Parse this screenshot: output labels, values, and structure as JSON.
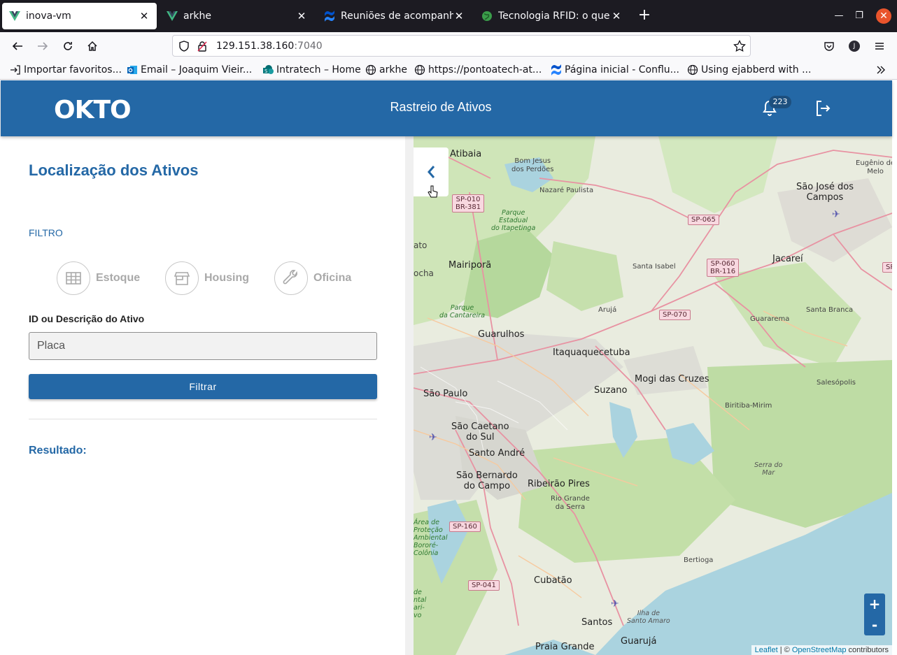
{
  "browser": {
    "tabs": [
      {
        "title": "inova-vm",
        "active": true,
        "icon": "vue-icon"
      },
      {
        "title": "arkhe",
        "active": false,
        "icon": "vue-icon"
      },
      {
        "title": "Reuniões de acompanhar",
        "active": false,
        "icon": "confluence-icon"
      },
      {
        "title": "Tecnologia RFID: o que é",
        "active": false,
        "icon": "globe-green-icon"
      }
    ],
    "url_host": "129.151.38.160",
    "url_port": ":7040",
    "profile_initial": "J",
    "bookmarks": [
      {
        "label": "Importar favoritos...",
        "icon": "import-icon"
      },
      {
        "label": "Email – Joaquim Vieir...",
        "icon": "outlook-icon"
      },
      {
        "label": "Intratech – Home",
        "icon": "sharepoint-icon"
      },
      {
        "label": "arkhe",
        "icon": "globe-icon"
      },
      {
        "label": "https://pontoatech-at...",
        "icon": "globe-icon"
      },
      {
        "label": "Página inicial - Conflu...",
        "icon": "confluence-icon"
      },
      {
        "label": "Using ejabberd with ...",
        "icon": "globe-icon"
      }
    ]
  },
  "header": {
    "logo": "OKTO",
    "title": "Rastreio de Ativos",
    "notification_count": "223"
  },
  "panel": {
    "title": "Localização dos Ativos",
    "filter_label": "FILTRO",
    "filters": [
      {
        "label": "Estoque",
        "icon": "grid-icon"
      },
      {
        "label": "Housing",
        "icon": "store-icon"
      },
      {
        "label": "Oficina",
        "icon": "wrench-icon"
      }
    ],
    "field_label": "ID ou Descrição do Ativo",
    "field_placeholder": "Placa",
    "filter_button": "Filtrar",
    "result_label": "Resultado:"
  },
  "map": {
    "places": {
      "atibaia": "Atibaia",
      "bom_jesus": "Bom Jesus\ndos Perdões",
      "nazare": "Nazaré Paulista",
      "sao_jose": "São José dos\nCampos",
      "eugenio": "Eugênio de\nMelo",
      "mairipora": "Mairiporã",
      "santa_isabel": "Santa Isabel",
      "jacarei": "Jacareí",
      "aruja": "Arujá",
      "santa_branca": "Santa Branca",
      "guararema": "Guararema",
      "guarulhos": "Guarulhos",
      "itaqua": "Itaquaquecetuba",
      "mogi": "Mogi das Cruzes",
      "suzano": "Suzano",
      "salesopolis": "Salesópolis",
      "sao_paulo": "São Paulo",
      "biritiba": "Biritiba-Mirim",
      "sao_caetano": "São Caetano\ndo Sul",
      "santo_andre": "Santo André",
      "sao_bernardo": "São Bernardo\ndo Campo",
      "ribeirao": "Ribeirão Pires",
      "rio_grande": "Rio Grande\nda Serra",
      "cubatao": "Cubatão",
      "santos": "Santos",
      "guaruja": "Guarujá",
      "praia_grande": "Praia Grande",
      "bertioga": "Bertioga",
      "ilha": "Ilha de\nSanto Amaro",
      "serra_mar": "Serra do\nMar",
      "pq_itapetinga": "Parque\nEstadual\ndo Itapetinga",
      "pq_cantareira": "Parque\nda Cantareira",
      "ato": "ato",
      "ocha": "ocha",
      "area_protecao": "Área de\nProteção\nAmbiental\nBororé-\nColônia",
      "ental": "de\nntal\nari-\nvo"
    },
    "shields": {
      "sp010": "SP-010\nBR-381",
      "sp065": "SP-065",
      "sp060": "SP-060\nBR-116",
      "sp070": "SP-070",
      "sp160": "SP-160",
      "sp041": "SP-041",
      "sp_edge": "SP"
    },
    "zoom_in": "+",
    "zoom_out": "-",
    "attribution_leaflet": "Leaflet",
    "attribution_sep": " | © ",
    "attribution_osm": "OpenStreetMap",
    "attribution_tail": " contributors"
  }
}
